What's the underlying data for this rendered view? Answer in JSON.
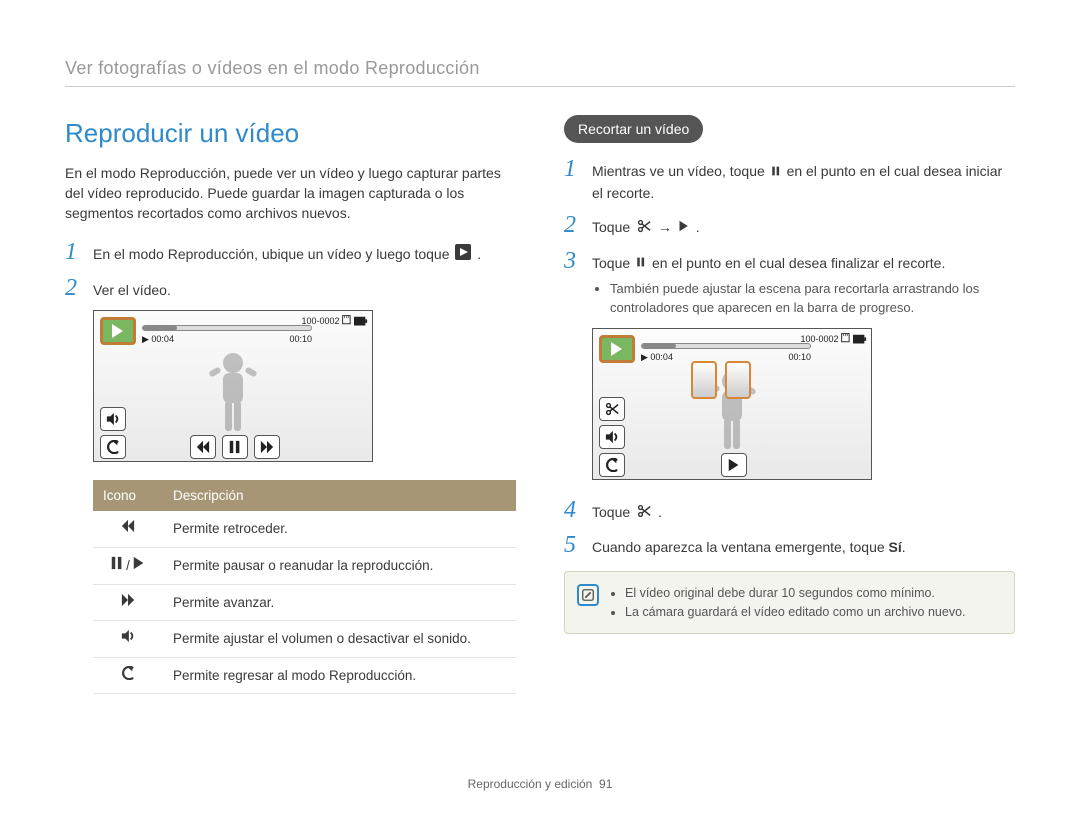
{
  "breadcrumb": "Ver fotografías o vídeos en el modo Reproducción",
  "footer": {
    "section": "Reproducción y edición",
    "page": "91"
  },
  "left": {
    "title": "Reproducir un vídeo",
    "intro": "En el modo Reproducción, puede ver un vídeo y luego capturar partes del vídeo reproducido. Puede guardar la imagen capturada o los segmentos recortados como archivos nuevos.",
    "step1a": "En el modo Reproducción, ubique un vídeo y luego toque ",
    "step1b": ".",
    "step2": "Ver el vídeo.",
    "lcd": {
      "elapsed": "00:04",
      "total": "00:10",
      "file": "100-0002"
    },
    "table": {
      "h1": "Icono",
      "h2": "Descripción",
      "r1": "Permite retroceder.",
      "r2": "Permite pausar o reanudar la reproducción.",
      "r3": "Permite avanzar.",
      "r4": "Permite ajustar el volumen o desactivar el sonido.",
      "r5": "Permite regresar al modo Reproducción."
    }
  },
  "right": {
    "badge": "Recortar un vídeo",
    "step1a": "Mientras ve un vídeo, toque ",
    "step1b": " en el punto en el cual desea iniciar el recorte.",
    "step2a": "Toque ",
    "step2b": " → ",
    "step2c": ".",
    "step3a": "Toque ",
    "step3b": " en el punto en el cual desea finalizar el recorte.",
    "step3bullet": "También puede ajustar la escena para recortarla arrastrando los controladores que aparecen en la barra de progreso.",
    "lcd": {
      "elapsed": "00:04",
      "total": "00:10",
      "file": "100-0002"
    },
    "step4a": "Toque ",
    "step4b": ".",
    "step5a": "Cuando aparezca la ventana emergente, toque ",
    "step5b": "Sí",
    "step5c": ".",
    "note1": "El vídeo original debe durar 10 segundos como mínimo.",
    "note2": "La cámara guardará el vídeo editado como un archivo nuevo."
  }
}
